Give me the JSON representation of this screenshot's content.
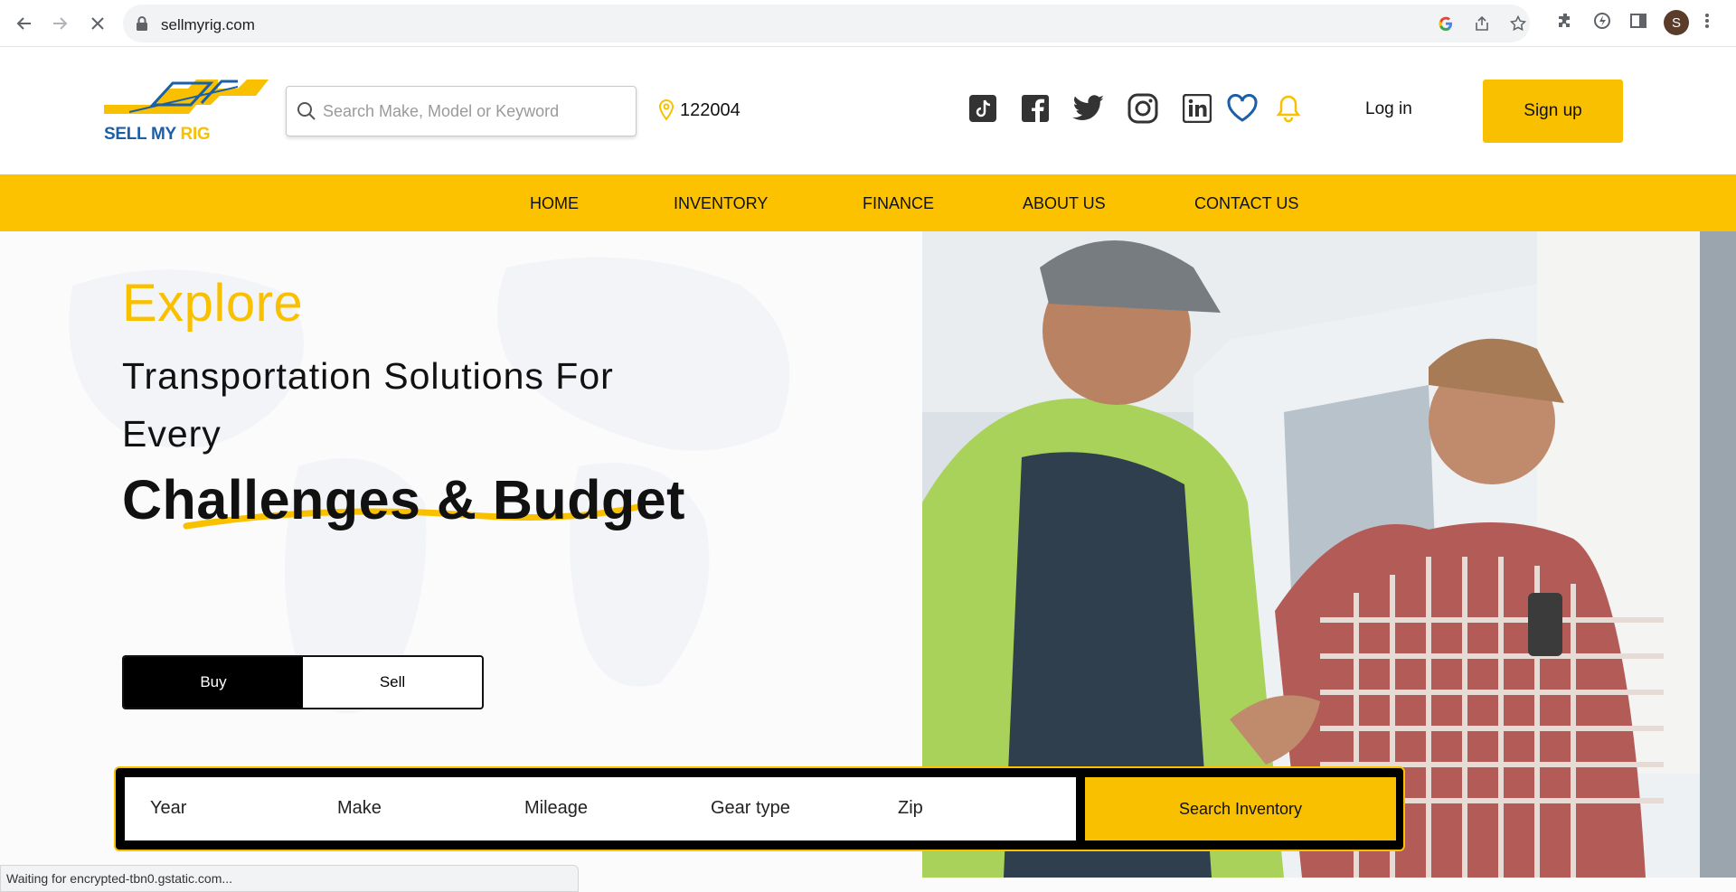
{
  "browser": {
    "url": "sellmyrig.com",
    "avatar_initial": "S",
    "status_text": "Waiting for encrypted-tbn0.gstatic.com..."
  },
  "header": {
    "logo_text_a": "SELL MY ",
    "logo_text_b": "RIG",
    "search_placeholder": "Search Make, Model or Keyword",
    "location": "122004",
    "login_label": "Log in",
    "signup_label": "Sign up",
    "social_icons": [
      "tiktok-icon",
      "facebook-icon",
      "twitter-icon",
      "instagram-icon",
      "linkedin-icon",
      "heart-icon",
      "bell-icon"
    ]
  },
  "nav": {
    "items": [
      "HOME",
      "INVENTORY",
      "FINANCE",
      "ABOUT US",
      "CONTACT US"
    ]
  },
  "hero": {
    "explore": "Explore",
    "tagline": "Transportation Solutions For Every",
    "tagline_big": "Challenges & Budget",
    "toggle": {
      "buy": "Buy",
      "sell": "Sell",
      "active": "Buy"
    }
  },
  "filters": {
    "fields": [
      "Year",
      "Make",
      "Mileage",
      "Gear type",
      "Zip"
    ],
    "search_button": "Search Inventory"
  },
  "colors": {
    "brand_yellow": "#f9c000",
    "brand_blue": "#1b5fa8",
    "dark": "#111111"
  }
}
